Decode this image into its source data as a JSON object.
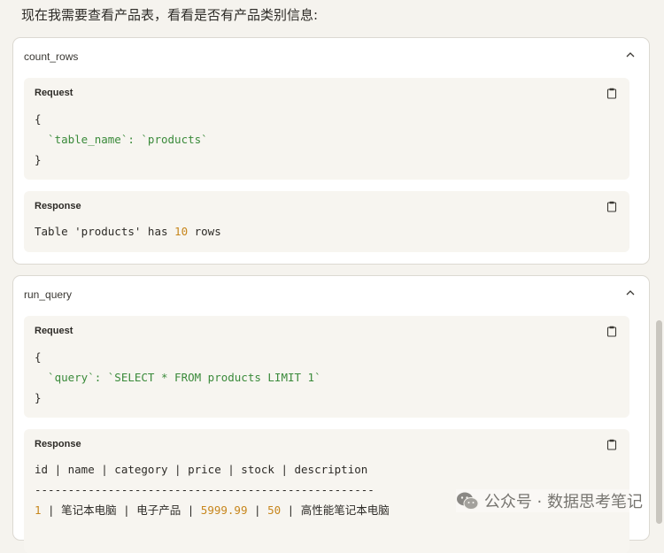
{
  "intro_text": "现在我需要查看产品表，看看是否有产品类别信息:",
  "tool_calls": [
    {
      "name": "count_rows",
      "request_label": "Request",
      "request_lines": [
        "{",
        "  `table_name`: `products`",
        "}"
      ],
      "response_label": "Response",
      "response_text_prefix": "Table 'products' has ",
      "response_number": "10",
      "response_text_suffix": " rows"
    },
    {
      "name": "run_query",
      "request_label": "Request",
      "request_lines": [
        "{",
        "  `query`: `SELECT * FROM products LIMIT 1`",
        "}"
      ],
      "response_label": "Response",
      "response_header": "id | name | category | price | stock | description",
      "response_divider": "---------------------------------------------------",
      "response_row": {
        "id": "1",
        "name": "笔记本电脑",
        "category": "电子产品",
        "price": "5999.99",
        "stock": "50",
        "description": "高性能笔记本电脑"
      }
    }
  ],
  "watermark": "公众号 · 数据思考笔记",
  "colors": {
    "background": "#f5f3ee",
    "card": "#ffffff",
    "panel": "#f7f5f0",
    "string": "#3a8a3a",
    "number": "#c7861c"
  },
  "icons": {
    "collapse": "chevron-up-icon",
    "copy": "clipboard-icon",
    "watermark": "wechat-icon"
  }
}
